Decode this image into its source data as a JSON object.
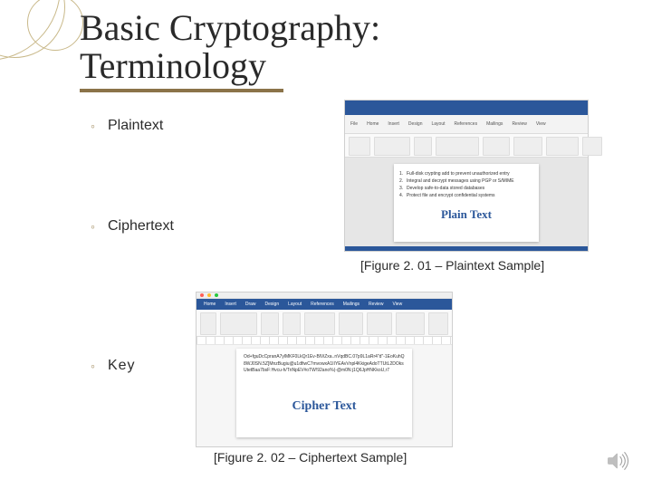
{
  "title": {
    "line1": "Basic Cryptography:",
    "line2": "Terminology"
  },
  "bullets": {
    "plaintext": "Plaintext",
    "ciphertext": "Ciphertext",
    "key": "Key"
  },
  "captions": {
    "fig1": "[Figure 2. 01 – Plaintext Sample]",
    "fig2": "[Figure 2. 02 – Ciphertext Sample]"
  },
  "word_mock_plain": {
    "ribbon_tabs": [
      "File",
      "Home",
      "Insert",
      "Design",
      "Layout",
      "References",
      "Mailings",
      "Review",
      "View"
    ],
    "list": [
      "Full-disk crypting add to prevent unauthorized entry",
      "Integral and decrypt messages using PGP or S/MIME",
      "Develop safe-to-data stored databases",
      "Protect file and encrypt confidential systems"
    ],
    "heading": "Plain Text"
  },
  "word_mock_cipher": {
    "ribbon_tabs": [
      "Home",
      "Insert",
      "Draw",
      "Design",
      "Layout",
      "References",
      "Mailings",
      "Review",
      "View"
    ],
    "cipher_blob": "Od+fguDcCpranA7ylMKF0LkQr1Ev-BlViZxa..nVqdBC.07p9L1aRr4\"d\"-1EoKuhQ8WJ0SN.5Z]MnzBugiu@u1dfiwC7mvowxA1IIYEAvVnpl4KkigeAdoTTUtL2DOksUtetBaa7bsF:Hvcu-h/TriNpEV#oTW!92ano%(-@m0N:j1Q6JpHNKkoU,r7",
    "heading": "Cipher Text"
  },
  "colors": {
    "accent_underline": "#8b7349",
    "word_blue": "#2b579a"
  }
}
